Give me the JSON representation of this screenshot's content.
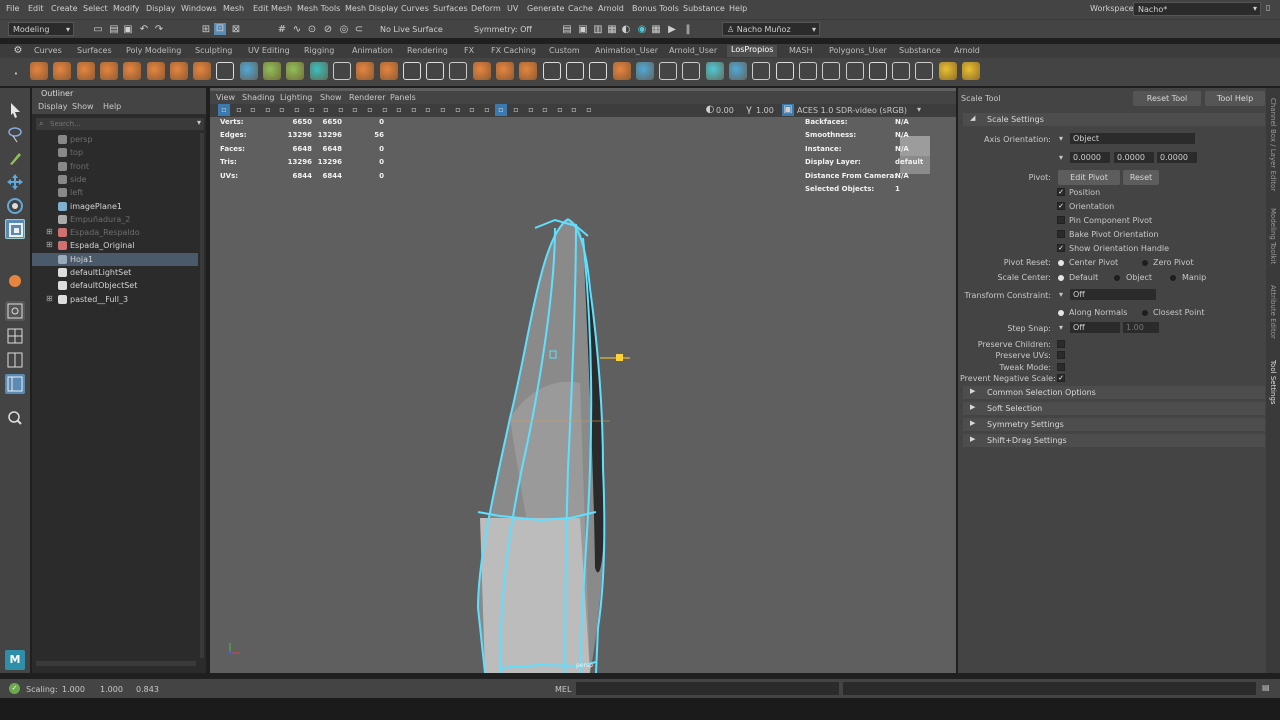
{
  "menubar": {
    "items": [
      "File",
      "Edit",
      "Create",
      "Select",
      "Modify",
      "Display",
      "Windows",
      "Mesh",
      "Edit Mesh",
      "Mesh Tools",
      "Mesh Display",
      "Curves",
      "Surfaces",
      "Deform",
      "UV",
      "Generate",
      "Cache",
      "Arnold",
      "Bonus Tools",
      "Substance",
      "Help"
    ],
    "workspace_label": "Workspace:",
    "workspace_value": "Nacho*"
  },
  "statusline": {
    "mode": "Modeling",
    "live_surface": "No Live Surface",
    "symmetry": "Symmetry: Off",
    "user": "Nacho Muñoz"
  },
  "shelf_tabs": [
    "Curves",
    "Surfaces",
    "Poly Modeling",
    "Sculpting",
    "UV Editing",
    "Rigging",
    "Animation",
    "Rendering",
    "FX",
    "FX Caching",
    "Custom",
    "Animation_User",
    "Arnold_User",
    "LosPropios",
    "MASH",
    "Polygons_User",
    "Substance",
    "Arnold"
  ],
  "shelf_active": "LosPropios",
  "outliner": {
    "title": "Outliner",
    "menu": [
      "Display",
      "Show",
      "Help"
    ],
    "search_placeholder": "Search...",
    "items": [
      {
        "label": "persp",
        "dim": true,
        "icon": "camera-icon"
      },
      {
        "label": "top",
        "dim": true,
        "icon": "camera-icon"
      },
      {
        "label": "front",
        "dim": true,
        "icon": "camera-icon"
      },
      {
        "label": "side",
        "dim": true,
        "icon": "camera-icon"
      },
      {
        "label": "left",
        "dim": true,
        "icon": "camera-icon"
      },
      {
        "label": "imagePlane1",
        "dim": false,
        "icon": "image-plane-icon"
      },
      {
        "label": "Empuñadura_2",
        "dim": true,
        "icon": "transform-icon"
      },
      {
        "label": "Espada_Respaldo",
        "dim": true,
        "icon": "group-icon",
        "expand": true
      },
      {
        "label": "Espada_Original",
        "dim": false,
        "icon": "group-icon",
        "expand": true
      },
      {
        "label": "Hoja1",
        "dim": false,
        "icon": "mesh-icon",
        "selected": true
      },
      {
        "label": "defaultLightSet",
        "dim": false,
        "icon": "set-icon"
      },
      {
        "label": "defaultObjectSet",
        "dim": false,
        "icon": "set-icon"
      },
      {
        "label": "pasted__Full_3",
        "dim": false,
        "icon": "set-icon",
        "expand": true
      }
    ]
  },
  "viewport": {
    "menu": [
      "View",
      "Shading",
      "Lighting",
      "Show",
      "Renderer",
      "Panels"
    ],
    "exposure": "0.00",
    "gamma": "1.00",
    "color_space": "ACES 1.0 SDR-video (sRGB)",
    "camera_label": "persp",
    "hud_left": [
      {
        "k": "Verts:",
        "a": "6650",
        "b": "6650",
        "c": "0"
      },
      {
        "k": "Edges:",
        "a": "13296",
        "b": "13296",
        "c": "56"
      },
      {
        "k": "Faces:",
        "a": "6648",
        "b": "6648",
        "c": "0"
      },
      {
        "k": "Tris:",
        "a": "13296",
        "b": "13296",
        "c": "0"
      },
      {
        "k": "UVs:",
        "a": "6844",
        "b": "6844",
        "c": "0"
      }
    ],
    "hud_right": [
      {
        "k": "Backfaces:",
        "v": "N/A"
      },
      {
        "k": "Smoothness:",
        "v": "N/A"
      },
      {
        "k": "Instance:",
        "v": "N/A"
      },
      {
        "k": "Display Layer:",
        "v": "default"
      },
      {
        "k": "Distance From Camera:",
        "v": "N/A"
      },
      {
        "k": "Selected Objects:",
        "v": "1"
      }
    ],
    "wire_color": "#5fe0ff"
  },
  "tool": {
    "title": "Scale Tool",
    "reset_btn": "Reset Tool",
    "help_btn": "Tool Help",
    "section": "Scale Settings",
    "axis_orientation_label": "Axis Orientation:",
    "axis_orientation": "Object",
    "xyz": [
      "0.0000",
      "0.0000",
      "0.0000"
    ],
    "pivot_label": "Pivot:",
    "edit_pivot": "Edit Pivot",
    "reset": "Reset",
    "checks": [
      {
        "label": "Position",
        "on": true
      },
      {
        "label": "Orientation",
        "on": true
      },
      {
        "label": "Pin Component Pivot",
        "on": false
      },
      {
        "label": "Bake Pivot Orientation",
        "on": false
      },
      {
        "label": "Show Orientation Handle",
        "on": true
      }
    ],
    "pivot_reset_label": "Pivot Reset:",
    "center_pivot": "Center Pivot",
    "zero_pivot": "Zero Pivot",
    "scale_center_label": "Scale Center:",
    "sc_default": "Default",
    "sc_object": "Object",
    "sc_manip": "Manip",
    "transform_constraint_label": "Transform Constraint:",
    "transform_constraint": "Off",
    "along_normals": "Along Normals",
    "closest_point": "Closest Point",
    "step_snap_label": "Step Snap:",
    "step_snap": "Off",
    "step_value": "1.00",
    "toggles": [
      {
        "label": "Preserve Children:",
        "on": false
      },
      {
        "label": "Preserve UVs:",
        "on": false
      },
      {
        "label": "Tweak Mode:",
        "on": false
      },
      {
        "label": "Prevent Negative Scale:",
        "on": true
      }
    ],
    "sections": [
      "Common Selection Options",
      "Soft Selection",
      "Symmetry Settings",
      "Shift+Drag Settings"
    ]
  },
  "side_tabs": [
    "Channel Box / Layer Editor",
    "Modeling Toolkit",
    "Attribute Editor",
    "Tool Settings"
  ],
  "bottom": {
    "scaling_label": "Scaling:",
    "x": "1.000",
    "y": "1.000",
    "z": "0.843",
    "mel": "MEL"
  }
}
